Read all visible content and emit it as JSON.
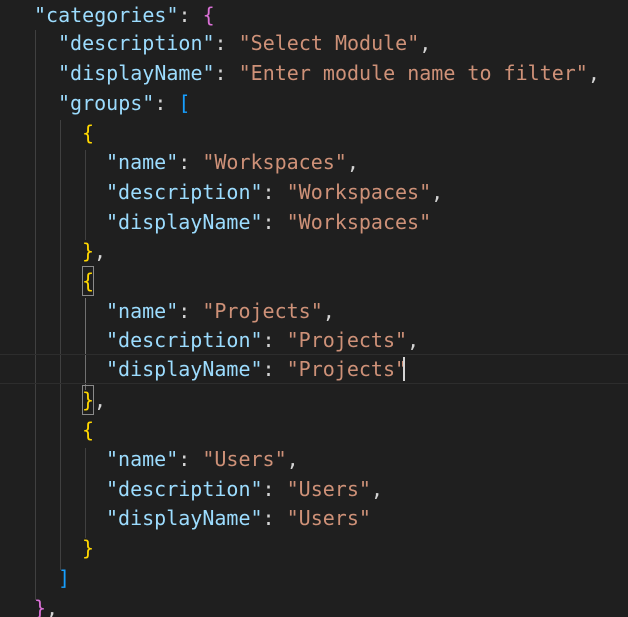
{
  "code": {
    "line1": {
      "key": "\"categories\"",
      "colon": ": ",
      "bracket": "{"
    },
    "line2": {
      "key": "\"description\"",
      "colon": ": ",
      "value": "\"Select Module\"",
      "comma": ","
    },
    "line3": {
      "key": "\"displayName\"",
      "colon": ": ",
      "value": "\"Enter module name to filter\"",
      "comma": ","
    },
    "line4": {
      "key": "\"groups\"",
      "colon": ": ",
      "bracket": "["
    },
    "line5": {
      "bracket": "{"
    },
    "line6": {
      "key": "\"name\"",
      "colon": ": ",
      "value": "\"Workspaces\"",
      "comma": ","
    },
    "line7": {
      "key": "\"description\"",
      "colon": ": ",
      "value": "\"Workspaces\"",
      "comma": ","
    },
    "line8": {
      "key": "\"displayName\"",
      "colon": ": ",
      "value": "\"Workspaces\""
    },
    "line9": {
      "bracket": "}",
      "comma": ","
    },
    "line10": {
      "bracket": "{"
    },
    "line11": {
      "key": "\"name\"",
      "colon": ": ",
      "value": "\"Projects\"",
      "comma": ","
    },
    "line12": {
      "key": "\"description\"",
      "colon": ": ",
      "value": "\"Projects\"",
      "comma": ","
    },
    "line13": {
      "key": "\"displayName\"",
      "colon": ": ",
      "value": "\"Projects\""
    },
    "line14": {
      "bracket": "}",
      "comma": ","
    },
    "line15": {
      "bracket": "{"
    },
    "line16": {
      "key": "\"name\"",
      "colon": ": ",
      "value": "\"Users\"",
      "comma": ","
    },
    "line17": {
      "key": "\"description\"",
      "colon": ": ",
      "value": "\"Users\"",
      "comma": ","
    },
    "line18": {
      "key": "\"displayName\"",
      "colon": ": ",
      "value": "\"Users\""
    },
    "line19": {
      "bracket": "}"
    },
    "line20": {
      "bracket": "]"
    },
    "line21": {
      "bracket": "}",
      "comma": ","
    }
  },
  "colors": {
    "background": "#1f1f1f",
    "key": "#9cdcfe",
    "string": "#ce9178",
    "punctuation": "#d4d4d4",
    "bracket_level1": "#da70d6",
    "bracket_level2": "#179fff",
    "bracket_level3": "#ffd700"
  }
}
